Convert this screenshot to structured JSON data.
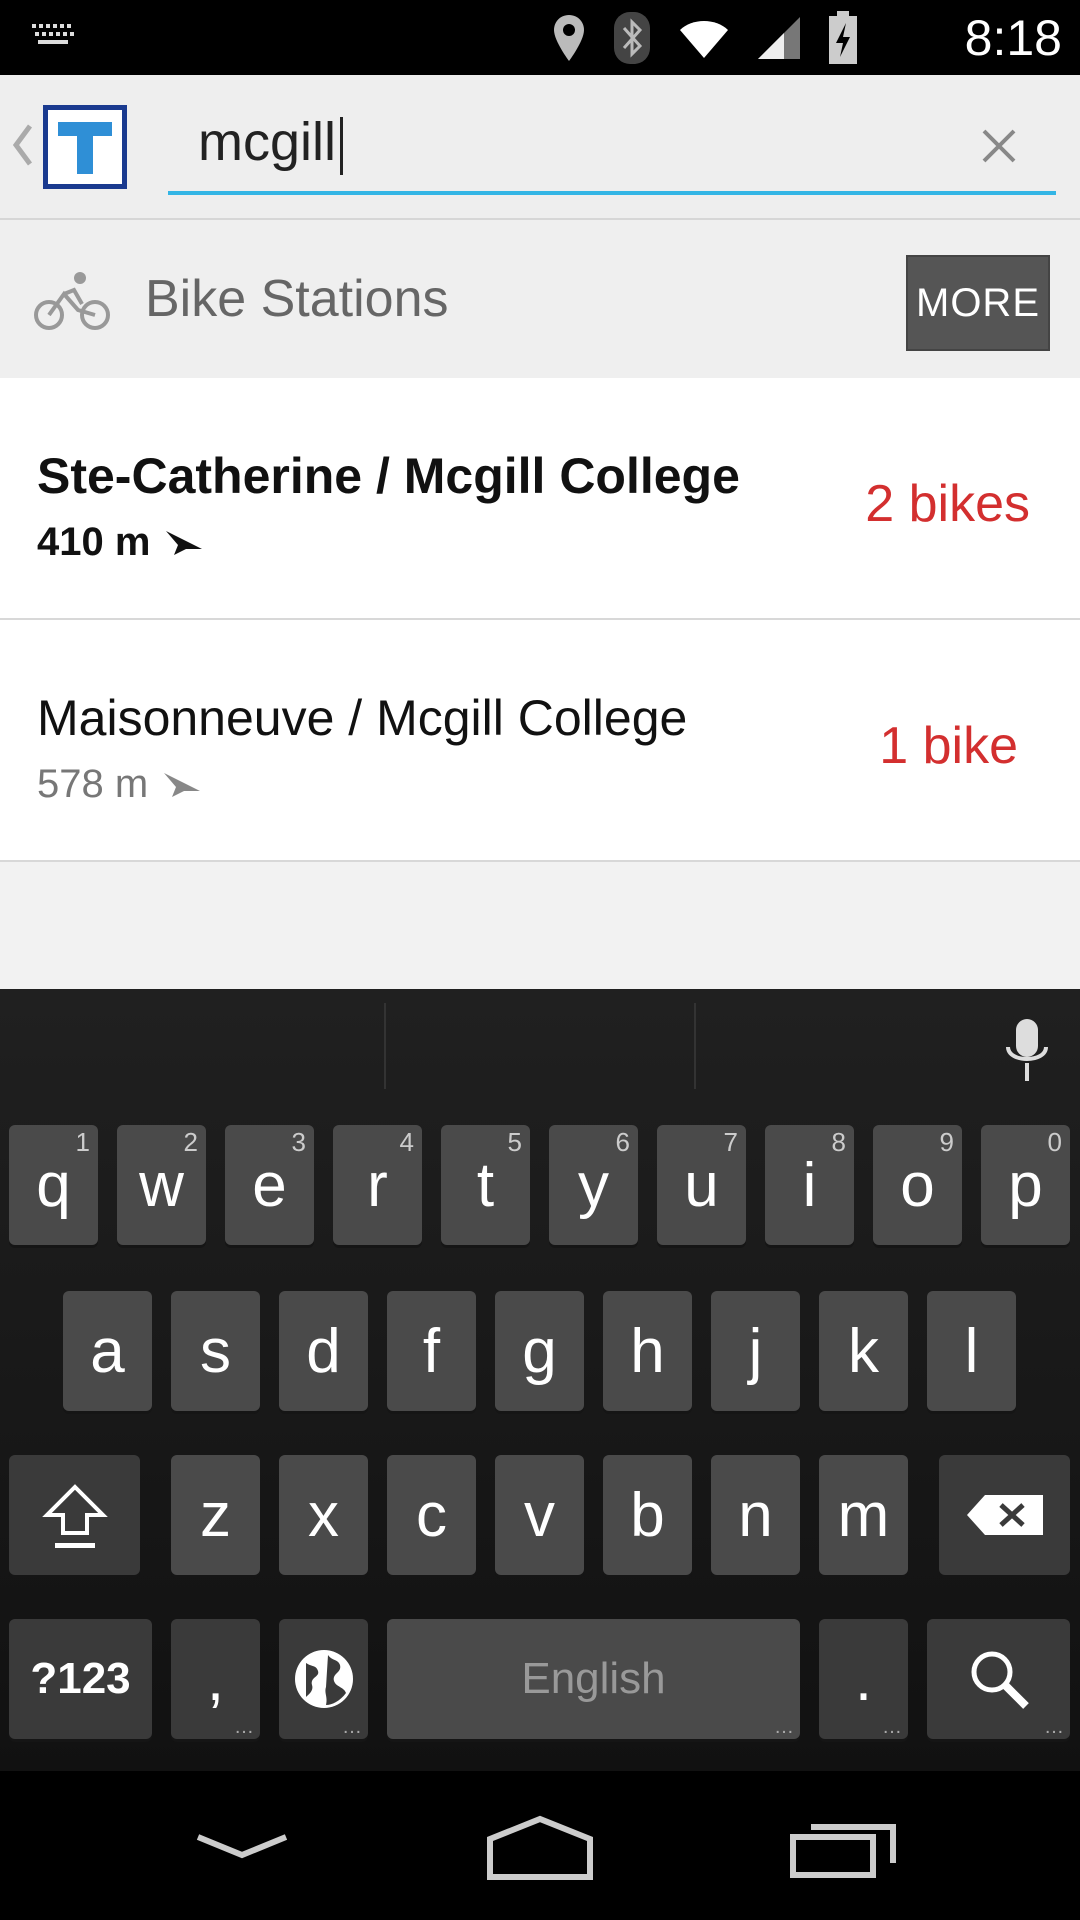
{
  "status_bar": {
    "time": "8:18",
    "icons": [
      "keyboard-icon",
      "location-pin-icon",
      "bluetooth-icon",
      "wifi-icon",
      "signal-icon",
      "battery-charging-icon"
    ]
  },
  "app_bar": {
    "logo_letter": "T",
    "search": {
      "value": "mcgill",
      "placeholder": ""
    }
  },
  "section": {
    "title": "Bike Stations",
    "more_label": "MORE"
  },
  "results": [
    {
      "name": "Ste-Catherine / Mcgill College",
      "distance": "410 m",
      "count": "2 bikes"
    },
    {
      "name": "Maisonneuve / Mcgill College",
      "distance": "578 m",
      "count": "1 bike"
    }
  ],
  "keyboard": {
    "row1": [
      {
        "letter": "q",
        "hint": "1"
      },
      {
        "letter": "w",
        "hint": "2"
      },
      {
        "letter": "e",
        "hint": "3"
      },
      {
        "letter": "r",
        "hint": "4"
      },
      {
        "letter": "t",
        "hint": "5"
      },
      {
        "letter": "y",
        "hint": "6"
      },
      {
        "letter": "u",
        "hint": "7"
      },
      {
        "letter": "i",
        "hint": "8"
      },
      {
        "letter": "o",
        "hint": "9"
      },
      {
        "letter": "p",
        "hint": "0"
      }
    ],
    "row2": [
      "a",
      "s",
      "d",
      "f",
      "g",
      "h",
      "j",
      "k",
      "l"
    ],
    "row3": [
      "z",
      "x",
      "c",
      "v",
      "b",
      "n",
      "m"
    ],
    "symbols_label": "?123",
    "comma": ",",
    "space_label": "English",
    "period": "."
  },
  "colors": {
    "accent": "#33b5e5",
    "availability": "#d32f2f",
    "logo_border": "#1a3a8f",
    "logo_letter": "#2f8fd6"
  }
}
